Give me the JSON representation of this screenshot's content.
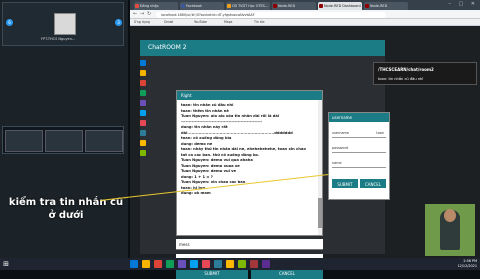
{
  "video": {
    "participant_name": "FPT-THCS Nguyen...",
    "badge_left": "6",
    "badge_right": "3"
  },
  "overlay": {
    "caption": "kiểm tra tin nhắn cũ ở dưới",
    "arrow_color": "#e8c832"
  },
  "browser": {
    "tabs": [
      {
        "label": "Đăng nhập",
        "icon_color": "#e64a3c"
      },
      {
        "label": "Facebook",
        "icon_color": "#3b5998"
      },
      {
        "label": "CĐ TVDT Học OTES...",
        "icon_color": "#f2a01b"
      },
      {
        "label": "Node-RED",
        "icon_color": "#8f0000"
      },
      {
        "label": "Node-RED Dashboard",
        "icon_color": "#8f0000"
      },
      {
        "label": "Node-RED",
        "icon_color": "#8f0000"
      }
    ],
    "active_tab": "Node-RED Dashboard",
    "url": "localhost:1880/ui/#!/0?socketid=dT-yfgstvauwNvvtAAF",
    "bookmarks": [
      "Ứng dụng",
      "Gmail",
      "YouTube",
      "Maps",
      "Tin tức"
    ]
  },
  "chat": {
    "room_title": "ChatROOM 2",
    "panel_title": "Right",
    "messages": [
      "toan: tin nhắn cũ đâu nhỉ",
      "toan: thêm tin nhắn nè",
      "Tuan Nguyen: alo alo xóa tin nhắn dài rồi là dài",
      "-----------------------------------------------------",
      "dung: tin nhắn này rất",
      "dài..............................................................ddddddd",
      "toan: có xuống dòng bìa",
      "dung: demo ne",
      "toan: nhảy thử tin nhắn dài ne, ehehehehehe, toan xin chao",
      "tat ca cac ban. thử có xuống dòng ko.",
      "Tuan Nguyen: demo vui qua ahaha",
      "Tuan Nguyen: demo xuoa xe",
      "Tuan Nguyen: demo vui ve",
      "dung: 1 + 1 = ?",
      "Tuan Nguyen: xin chao cac ban",
      "toan: hi bro",
      "dung: ok mam"
    ],
    "input_message_label": "mess",
    "input_name_label": "mess",
    "submit_label": "SUBMIT",
    "cancel_label": "CANCEL"
  },
  "user_panel": {
    "title": "username",
    "username_label": "username",
    "username_value": "toan",
    "password_label": "password",
    "name_label": "name",
    "submit_label": "SUBMIT",
    "cancel_label": "CANCEL"
  },
  "popup": {
    "url": "/THCSCEARN/chat/room2",
    "message": "toan: tin nhắn cũ đâu nhỉ"
  },
  "taskbar": {
    "time": "2:56 PM",
    "date": "12/12/2021",
    "icon_colors": [
      "#0078d7",
      "#f4b400",
      "#db4437",
      "#0f9d58",
      "#6b4fbb",
      "#00a1f1",
      "#e74856",
      "#2d7d9a",
      "#ffb900",
      "#7fba00",
      "#a4373a",
      "#5c2d91"
    ]
  }
}
